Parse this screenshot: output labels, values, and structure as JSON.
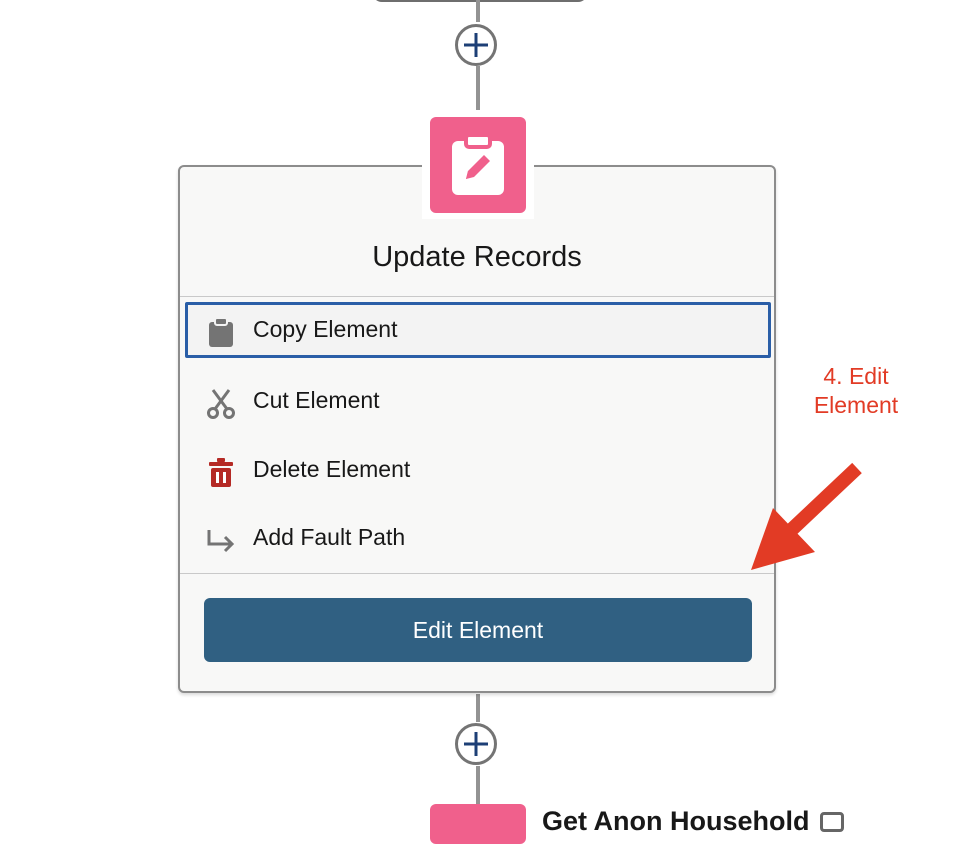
{
  "node": {
    "title": "Update Records",
    "icon": "clipboard-edit-icon",
    "color": "#f0608c"
  },
  "menu": {
    "items": [
      {
        "label": "Copy Element",
        "icon": "clipboard-icon"
      },
      {
        "label": "Cut Element",
        "icon": "scissors-icon"
      },
      {
        "label": "Delete Element",
        "icon": "trash-icon"
      },
      {
        "label": "Add Fault Path",
        "icon": "fault-path-arrow-icon"
      }
    ],
    "primary_action": "Edit Element"
  },
  "annotation": {
    "line1": "4. Edit",
    "line2": "Element",
    "color": "#e23b25"
  },
  "next_node": {
    "label": "Get Anon Household"
  },
  "colors": {
    "primary_button": "#306082",
    "focus_ring": "#2a5ea7",
    "delete_icon": "#b52a25"
  }
}
